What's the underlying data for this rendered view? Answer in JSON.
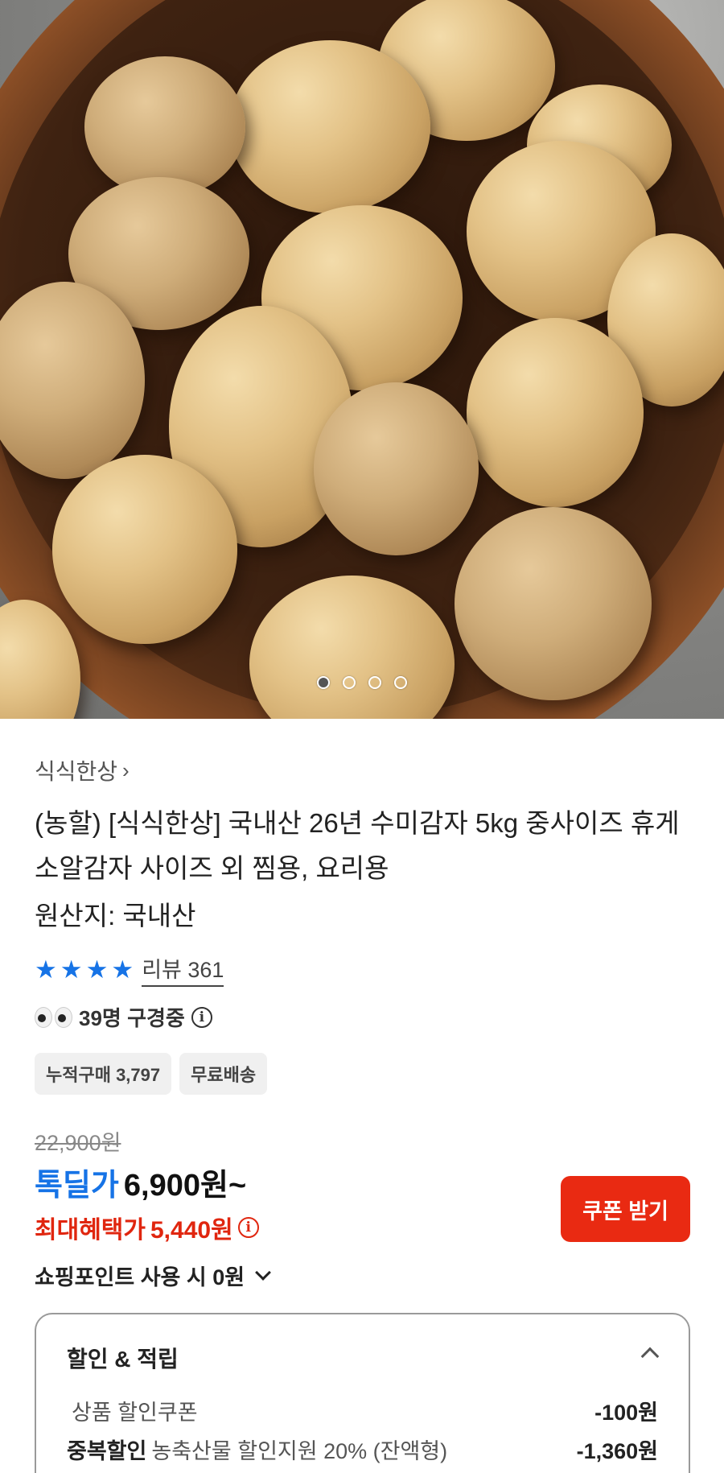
{
  "carousel": {
    "total": 4,
    "active_index": 0
  },
  "product": {
    "brand": "식식한상",
    "title": "(농할) [식식한상] 국내산 26년 수미감자 5kg 중사이즈 휴게소알감자 사이즈 외 찜용, 요리용",
    "origin": "원산지: 국내산",
    "rating_stars": 4,
    "review_text": "리뷰 361",
    "viewers_text": "39명 구경중",
    "chips": [
      "누적구매 3,797",
      "무료배송"
    ]
  },
  "pricing": {
    "original_price": "22,900원",
    "deal_label": "톡딜가",
    "deal_price": "6,900원~",
    "max_benefit_label": "최대혜택가",
    "max_benefit_price": "5,440원",
    "coupon_button": "쿠폰 받기",
    "points_text": "쇼핑포인트 사용 시 0원"
  },
  "discount": {
    "title": "할인 & 적립",
    "rows": [
      {
        "emphasis": "",
        "label": "상품 할인쿠폰",
        "amount": "-100원"
      },
      {
        "emphasis": "중복할인",
        "label": "농축산물 할인지원 20% (잔액형)",
        "amount": "-1,360원"
      }
    ]
  },
  "colors": {
    "accent_blue": "#1673e6",
    "accent_red": "#e92a12"
  }
}
